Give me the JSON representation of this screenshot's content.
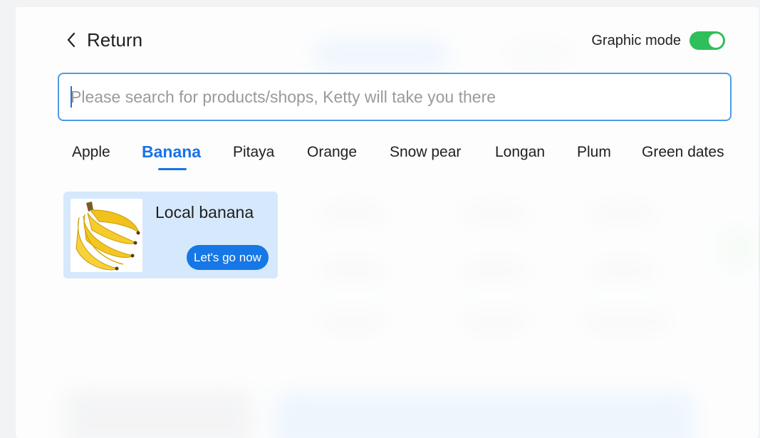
{
  "header": {
    "back_label": "Return",
    "mode_label": "Graphic mode",
    "mode_on": true
  },
  "search": {
    "placeholder": "Please search for products/shops, Ketty will take you there",
    "value": ""
  },
  "tabs": [
    {
      "label": "Apple",
      "active": false
    },
    {
      "label": "Banana",
      "active": true
    },
    {
      "label": "Pitaya",
      "active": false
    },
    {
      "label": "Orange",
      "active": false
    },
    {
      "label": "Snow pear",
      "active": false
    },
    {
      "label": "Longan",
      "active": false
    },
    {
      "label": "Plum",
      "active": false
    },
    {
      "label": "Green dates",
      "active": false
    }
  ],
  "results": [
    {
      "title": "Local banana",
      "button_label": "Let's go now",
      "image_icon": "banana-image"
    }
  ],
  "colors": {
    "accent": "#1a73e8",
    "toggle_on": "#2fbf5a",
    "card_bg": "#d6e8fb",
    "button_bg": "#1677e6"
  }
}
